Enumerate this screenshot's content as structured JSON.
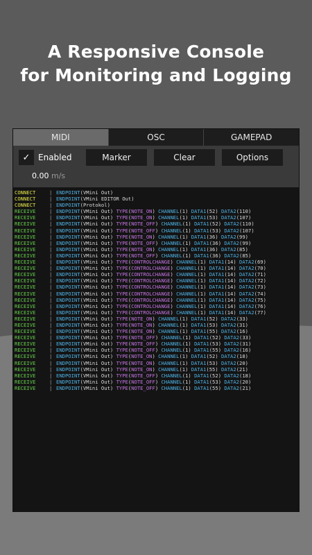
{
  "promo": {
    "line1": "A Responsive Console",
    "line2": "for Monitoring and Logging"
  },
  "tabs": [
    {
      "label": "MIDI",
      "active": true
    },
    {
      "label": "OSC",
      "active": false
    },
    {
      "label": "GAMEPAD",
      "active": false
    }
  ],
  "toolbar": {
    "enabled_checked": true,
    "enabled_label": "Enabled",
    "marker_label": "Marker",
    "clear_label": "Clear",
    "options_label": "Options",
    "rate_value": "0.00",
    "rate_unit": "m/s"
  },
  "log": [
    {
      "kind": "CONNECT",
      "msg": "ENDPOINT(VMini Out)"
    },
    {
      "kind": "CONNECT",
      "msg": "ENDPOINT(VMini EDITOR Out)"
    },
    {
      "kind": "CONNECT",
      "msg": "ENDPOINT(Protokol)"
    },
    {
      "kind": "RECEIVE",
      "endpoint": "VMini Out",
      "type": "NOTE_ON",
      "channel": "1",
      "d1": "52",
      "d2": "110"
    },
    {
      "kind": "RECEIVE",
      "endpoint": "VMini Out",
      "type": "NOTE_ON",
      "channel": "1",
      "d1": "53",
      "d2": "107"
    },
    {
      "kind": "RECEIVE",
      "endpoint": "VMini Out",
      "type": "NOTE_OFF",
      "channel": "1",
      "d1": "52",
      "d2": "110"
    },
    {
      "kind": "RECEIVE",
      "endpoint": "VMini Out",
      "type": "NOTE_OFF",
      "channel": "1",
      "d1": "53",
      "d2": "107"
    },
    {
      "kind": "RECEIVE",
      "endpoint": "VMini Out",
      "type": "NOTE_ON",
      "channel": "1",
      "d1": "36",
      "d2": "99"
    },
    {
      "kind": "RECEIVE",
      "endpoint": "VMini Out",
      "type": "NOTE_OFF",
      "channel": "1",
      "d1": "36",
      "d2": "99"
    },
    {
      "kind": "RECEIVE",
      "endpoint": "VMini Out",
      "type": "NOTE_ON",
      "channel": "1",
      "d1": "36",
      "d2": "85"
    },
    {
      "kind": "RECEIVE",
      "endpoint": "VMini Out",
      "type": "NOTE_OFF",
      "channel": "1",
      "d1": "36",
      "d2": "85"
    },
    {
      "kind": "RECEIVE",
      "endpoint": "VMini Out",
      "type": "CONTROLCHANGE",
      "channel": "1",
      "d1": "14",
      "d2": "69"
    },
    {
      "kind": "RECEIVE",
      "endpoint": "VMini Out",
      "type": "CONTROLCHANGE",
      "channel": "1",
      "d1": "14",
      "d2": "70"
    },
    {
      "kind": "RECEIVE",
      "endpoint": "VMini Out",
      "type": "CONTROLCHANGE",
      "channel": "1",
      "d1": "14",
      "d2": "71"
    },
    {
      "kind": "RECEIVE",
      "endpoint": "VMini Out",
      "type": "CONTROLCHANGE",
      "channel": "1",
      "d1": "14",
      "d2": "72"
    },
    {
      "kind": "RECEIVE",
      "endpoint": "VMini Out",
      "type": "CONTROLCHANGE",
      "channel": "1",
      "d1": "14",
      "d2": "73"
    },
    {
      "kind": "RECEIVE",
      "endpoint": "VMini Out",
      "type": "CONTROLCHANGE",
      "channel": "1",
      "d1": "14",
      "d2": "74"
    },
    {
      "kind": "RECEIVE",
      "endpoint": "VMini Out",
      "type": "CONTROLCHANGE",
      "channel": "1",
      "d1": "14",
      "d2": "75"
    },
    {
      "kind": "RECEIVE",
      "endpoint": "VMini Out",
      "type": "CONTROLCHANGE",
      "channel": "1",
      "d1": "14",
      "d2": "76"
    },
    {
      "kind": "RECEIVE",
      "endpoint": "VMini Out",
      "type": "CONTROLCHANGE",
      "channel": "1",
      "d1": "14",
      "d2": "77"
    },
    {
      "kind": "RECEIVE",
      "endpoint": "VMini Out",
      "type": "NOTE_ON",
      "channel": "1",
      "d1": "52",
      "d2": "33"
    },
    {
      "kind": "RECEIVE",
      "endpoint": "VMini Out",
      "type": "NOTE_ON",
      "channel": "1",
      "d1": "53",
      "d2": "31"
    },
    {
      "kind": "RECEIVE",
      "endpoint": "VMini Out",
      "type": "NOTE_ON",
      "channel": "1",
      "d1": "55",
      "d2": "16"
    },
    {
      "kind": "RECEIVE",
      "endpoint": "VMini Out",
      "type": "NOTE_OFF",
      "channel": "1",
      "d1": "52",
      "d2": "33"
    },
    {
      "kind": "RECEIVE",
      "endpoint": "VMini Out",
      "type": "NOTE_OFF",
      "channel": "1",
      "d1": "53",
      "d2": "31"
    },
    {
      "kind": "RECEIVE",
      "endpoint": "VMini Out",
      "type": "NOTE_OFF",
      "channel": "1",
      "d1": "55",
      "d2": "16"
    },
    {
      "kind": "RECEIVE",
      "endpoint": "VMini Out",
      "type": "NOTE_ON",
      "channel": "1",
      "d1": "52",
      "d2": "18"
    },
    {
      "kind": "RECEIVE",
      "endpoint": "VMini Out",
      "type": "NOTE_ON",
      "channel": "1",
      "d1": "53",
      "d2": "20"
    },
    {
      "kind": "RECEIVE",
      "endpoint": "VMini Out",
      "type": "NOTE_ON",
      "channel": "1",
      "d1": "55",
      "d2": "21"
    },
    {
      "kind": "RECEIVE",
      "endpoint": "VMini Out",
      "type": "NOTE_OFF",
      "channel": "1",
      "d1": "52",
      "d2": "18"
    },
    {
      "kind": "RECEIVE",
      "endpoint": "VMini Out",
      "type": "NOTE_OFF",
      "channel": "1",
      "d1": "53",
      "d2": "20"
    },
    {
      "kind": "RECEIVE",
      "endpoint": "VMini Out",
      "type": "NOTE_OFF",
      "channel": "1",
      "d1": "55",
      "d2": "21"
    }
  ],
  "colors": {
    "connect": "#e8e84a",
    "receive": "#68d24c",
    "endpoint": "#4fb3e6",
    "type": "#c776e6",
    "active_tab": "#6a6a6a"
  }
}
